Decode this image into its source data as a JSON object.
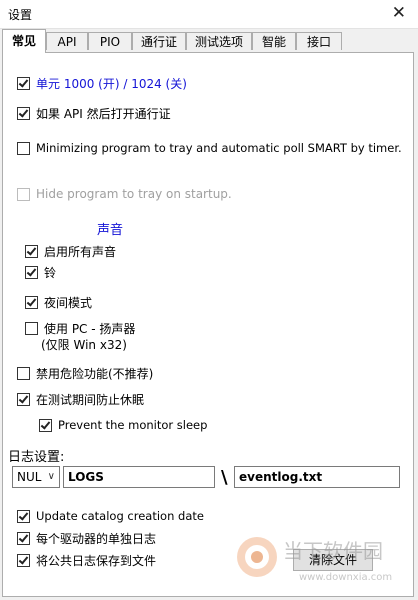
{
  "window": {
    "title": "设置",
    "close_glyph": "✕"
  },
  "tabs": [
    "常见",
    "API",
    "PIO",
    "通行证",
    "测试选项",
    "智能",
    "接口"
  ],
  "options": {
    "unit": {
      "label": "单元 1000 (开) / 1024 (关)",
      "checked": true
    },
    "api_pass": {
      "label": "如果 API 然后打开通行证",
      "checked": true
    },
    "minimize_tray": {
      "label": "Minimizing program to tray and automatic poll SMART by timer.",
      "checked": false
    },
    "hide_startup": {
      "label": "Hide program to tray on startup.",
      "checked": false,
      "disabled": true
    }
  },
  "sound": {
    "header": "声音",
    "enable_all": {
      "label": "启用所有声音",
      "checked": true
    },
    "bell": {
      "label": "铃",
      "checked": true
    },
    "night_mode": {
      "label": "夜间模式",
      "checked": true
    },
    "pc_speaker": {
      "label": "使用 PC - 扬声器",
      "sublabel": "(仅限 Win x32)",
      "checked": false
    }
  },
  "power": {
    "disable_dangerous": {
      "label": "禁用危险功能(不推荐)",
      "checked": false
    },
    "prevent_sleep": {
      "label": "在测试期间防止休眠",
      "checked": true
    },
    "prevent_monitor": {
      "label": "Prevent the monitor sleep",
      "checked": true
    }
  },
  "log": {
    "header": "日志设置:",
    "device": "NUL",
    "folder": "LOGS",
    "separator": "\\",
    "file": "eventlog.txt",
    "update_catalog": {
      "label": "Update catalog creation date",
      "checked": true
    },
    "per_drive": {
      "label": "每个驱动器的单独日志",
      "checked": true
    },
    "public_log": {
      "label": "将公共日志保存到文件",
      "checked": true
    },
    "clear_button": "清除文件"
  },
  "watermark": {
    "text": "当下软件园",
    "url": "www.downxia.com"
  }
}
